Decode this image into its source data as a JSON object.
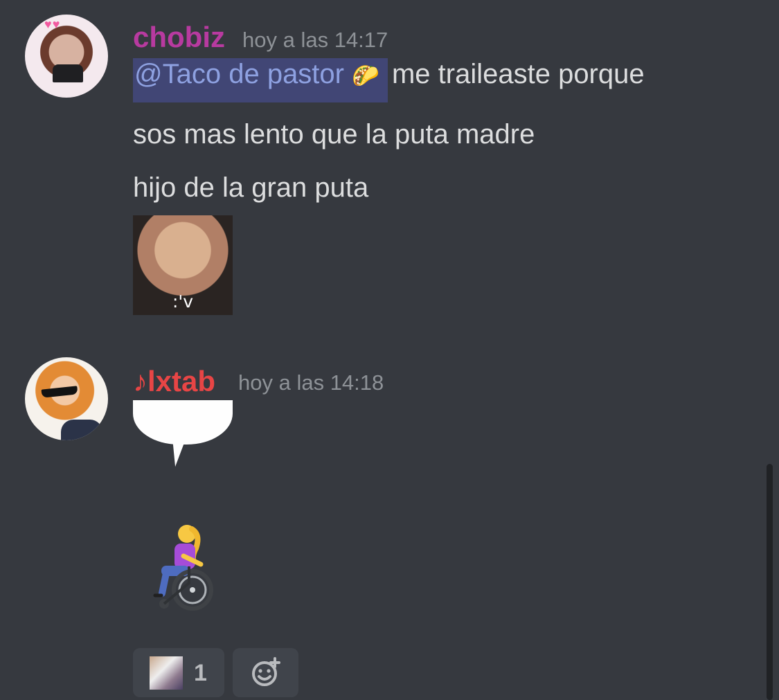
{
  "messages": [
    {
      "author": "chobiz",
      "timestamp": "hoy a las 14:17",
      "mention": "@Taco de pastor",
      "mention_emoji": "🌮",
      "line1_rest": "me traileaste porque",
      "line2": "sos mas lento que la puta madre",
      "line3": "hijo de la gran puta",
      "sticker_caption": ":'v",
      "author_color": "#b83aa0"
    },
    {
      "author": "♪lxtab",
      "timestamp": "hoy a las 14:18",
      "attachments": [
        "speech-bubble-sticker",
        "woman-in-manual-wheelchair-emoji"
      ],
      "author_color": "#e84545"
    }
  ],
  "reactions": [
    {
      "icon": "custom-emoji",
      "count": "1"
    }
  ],
  "theme": {
    "background": "#36393f",
    "mention_bg": "#414675",
    "mention_fg": "#8ea1e1",
    "text": "#dcddde",
    "muted": "#8e9297"
  }
}
